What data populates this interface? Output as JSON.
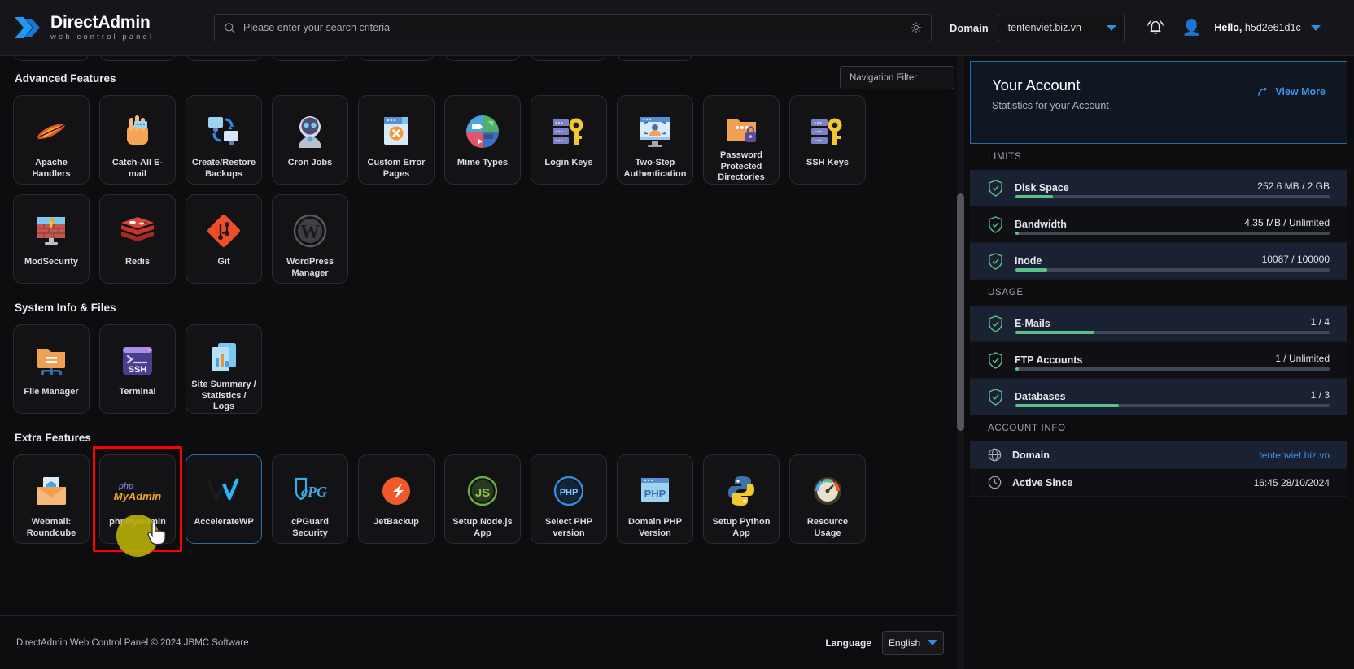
{
  "header": {
    "logo_title": "DirectAdmin",
    "logo_sub": "web control panel",
    "search_placeholder": "Please enter your search criteria",
    "search_value": "",
    "domain_label": "Domain",
    "domain_value": "tentenviet.biz.vn",
    "greeting_prefix": "Hello,",
    "username": "h5d2e61d1c"
  },
  "main": {
    "nav_filter_placeholder": "Navigation Filter",
    "sections": [
      {
        "title": "Advanced Features",
        "tiles": [
          {
            "label": "Apache Handlers",
            "icon": "feather-icon"
          },
          {
            "label": "Catch-All E-mail",
            "icon": "hand-catch-icon"
          },
          {
            "label": "Create/Restore Backups",
            "icon": "backup-sync-icon"
          },
          {
            "label": "Cron Jobs",
            "icon": "robot-icon"
          },
          {
            "label": "Custom Error Pages",
            "icon": "error-page-icon"
          },
          {
            "label": "Mime Types",
            "icon": "mime-pie-icon"
          },
          {
            "label": "Login Keys",
            "icon": "server-key-icon"
          },
          {
            "label": "Two-Step Authentication",
            "icon": "monitor-user-icon"
          },
          {
            "label": "Password Protected Directories",
            "icon": "folder-lock-icon"
          },
          {
            "label": "SSH Keys",
            "icon": "server-key-icon"
          },
          {
            "label": "ModSecurity",
            "icon": "firewall-icon"
          },
          {
            "label": "Redis",
            "icon": "redis-icon"
          },
          {
            "label": "Git",
            "icon": "git-icon"
          },
          {
            "label": "WordPress Manager",
            "icon": "wordpress-icon"
          }
        ]
      },
      {
        "title": "System Info & Files",
        "tiles": [
          {
            "label": "File Manager",
            "icon": "folder-network-icon"
          },
          {
            "label": "Terminal",
            "icon": "ssh-terminal-icon"
          },
          {
            "label": "Site Summary / Statistics / Logs",
            "icon": "stats-doc-icon"
          }
        ]
      },
      {
        "title": "Extra Features",
        "tiles": [
          {
            "label": "Webmail: Roundcube",
            "icon": "webmail-icon"
          },
          {
            "label": "phpMyAdmin",
            "icon": "phpmyadmin-icon"
          },
          {
            "label": "AccelerateWP",
            "icon": "acceleratewp-icon"
          },
          {
            "label": "cPGuard Security",
            "icon": "cpguard-icon"
          },
          {
            "label": "JetBackup",
            "icon": "jetbackup-icon"
          },
          {
            "label": "Setup Node.js App",
            "icon": "nodejs-icon"
          },
          {
            "label": "Select PHP version",
            "icon": "php-circle-icon"
          },
          {
            "label": "Domain PHP Version",
            "icon": "php-box-icon"
          },
          {
            "label": "Setup Python App",
            "icon": "python-icon"
          },
          {
            "label": "Resource Usage",
            "icon": "gauge-icon"
          }
        ]
      }
    ]
  },
  "footer": {
    "copyright": "DirectAdmin Web Control Panel © 2024 JBMC Software",
    "language_label": "Language",
    "language_value": "English"
  },
  "sidebar": {
    "card": {
      "title": "Your Account",
      "subtitle": "Statistics for your Account",
      "view_more": "View More"
    },
    "groups": [
      {
        "heading": "LIMITS",
        "rows": [
          {
            "name": "Disk Space",
            "value": "252.6 MB / 2 GB",
            "percent": 12
          },
          {
            "name": "Bandwidth",
            "value": "4.35 MB / Unlimited",
            "percent": 1
          },
          {
            "name": "Inode",
            "value": "10087 / 100000",
            "percent": 10
          }
        ]
      },
      {
        "heading": "USAGE",
        "rows": [
          {
            "name": "E-Mails",
            "value": "1 / 4",
            "percent": 25
          },
          {
            "name": "FTP Accounts",
            "value": "1 / Unlimited",
            "percent": 1
          },
          {
            "name": "Databases",
            "value": "1 / 3",
            "percent": 33
          }
        ]
      }
    ],
    "account_info": {
      "heading": "ACCOUNT INFO",
      "rows": [
        {
          "name": "Domain",
          "value": "tentenviet.biz.vn",
          "icon": "globe-icon",
          "link": true
        },
        {
          "name": "Active Since",
          "value": "16:45 28/10/2024",
          "icon": "clock-icon",
          "link": false
        }
      ]
    }
  },
  "colors": {
    "accent_blue": "#3f92e3",
    "highlight_red": "#ff0000",
    "progress_green": "#5cc08a",
    "click_blob": "#b5ad08"
  }
}
